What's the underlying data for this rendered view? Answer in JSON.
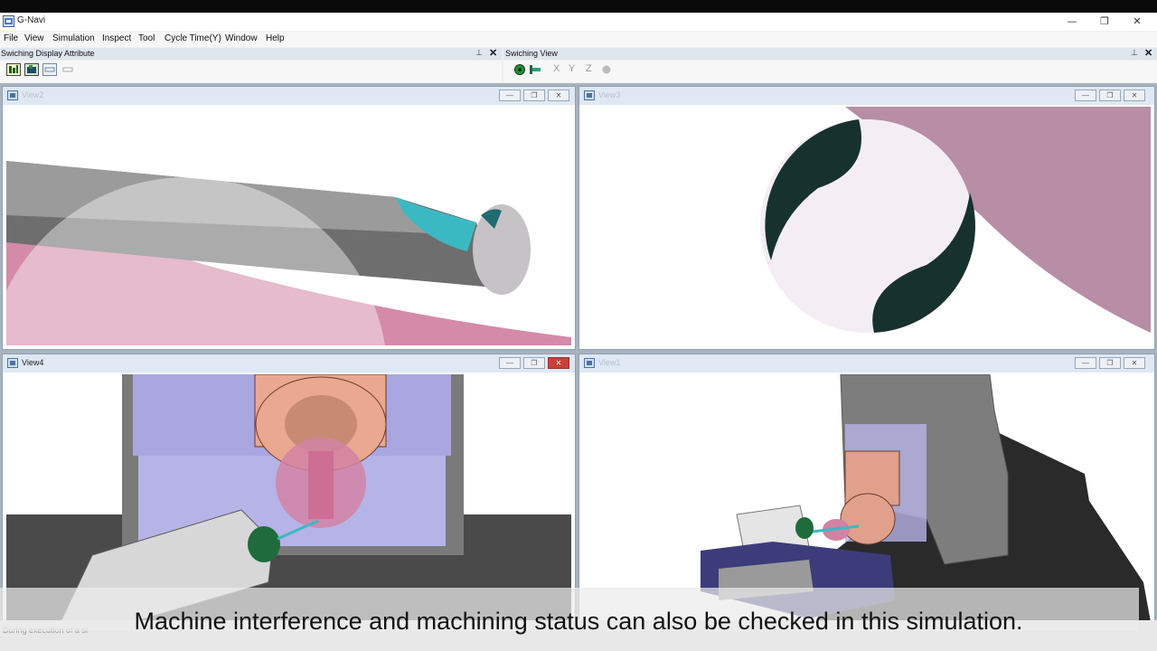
{
  "app": {
    "title": "G-Navi"
  },
  "window_controls": {
    "minimize": "—",
    "restore": "❐",
    "close": "✕"
  },
  "menu": [
    "File",
    "View",
    "Simulation",
    "Inspect",
    "Tool",
    "Cycle Time(Y)",
    "Window",
    "Help"
  ],
  "toolbars": {
    "left": {
      "title": "Swiching Display Attribute",
      "pin": "📌",
      "close": "✕"
    },
    "right": {
      "title": "Swiching View",
      "pin": "📌",
      "close": "✕",
      "axis_x": "X",
      "axis_y": "Y",
      "axis_z": "Z"
    }
  },
  "views": {
    "top_left": {
      "name": "View2",
      "active": false
    },
    "top_right": {
      "name": "View3",
      "active": false
    },
    "bottom_left": {
      "name": "View4",
      "active": true
    },
    "bottom_right": {
      "name": "View1",
      "active": false
    }
  },
  "child_controls": {
    "minimize": "—",
    "restore": "❐",
    "close": "✕"
  },
  "status": {
    "text": "During execution of a si"
  },
  "caption": "Machine interference and machining status can also be checked in this simulation.",
  "colors": {
    "accent_close": "#c94138",
    "workpiece_pink": "#c98aa6",
    "tool_teal": "#3bb9c3",
    "dark_teal": "#17312f",
    "stock_lavender": "#a9a6e0"
  }
}
